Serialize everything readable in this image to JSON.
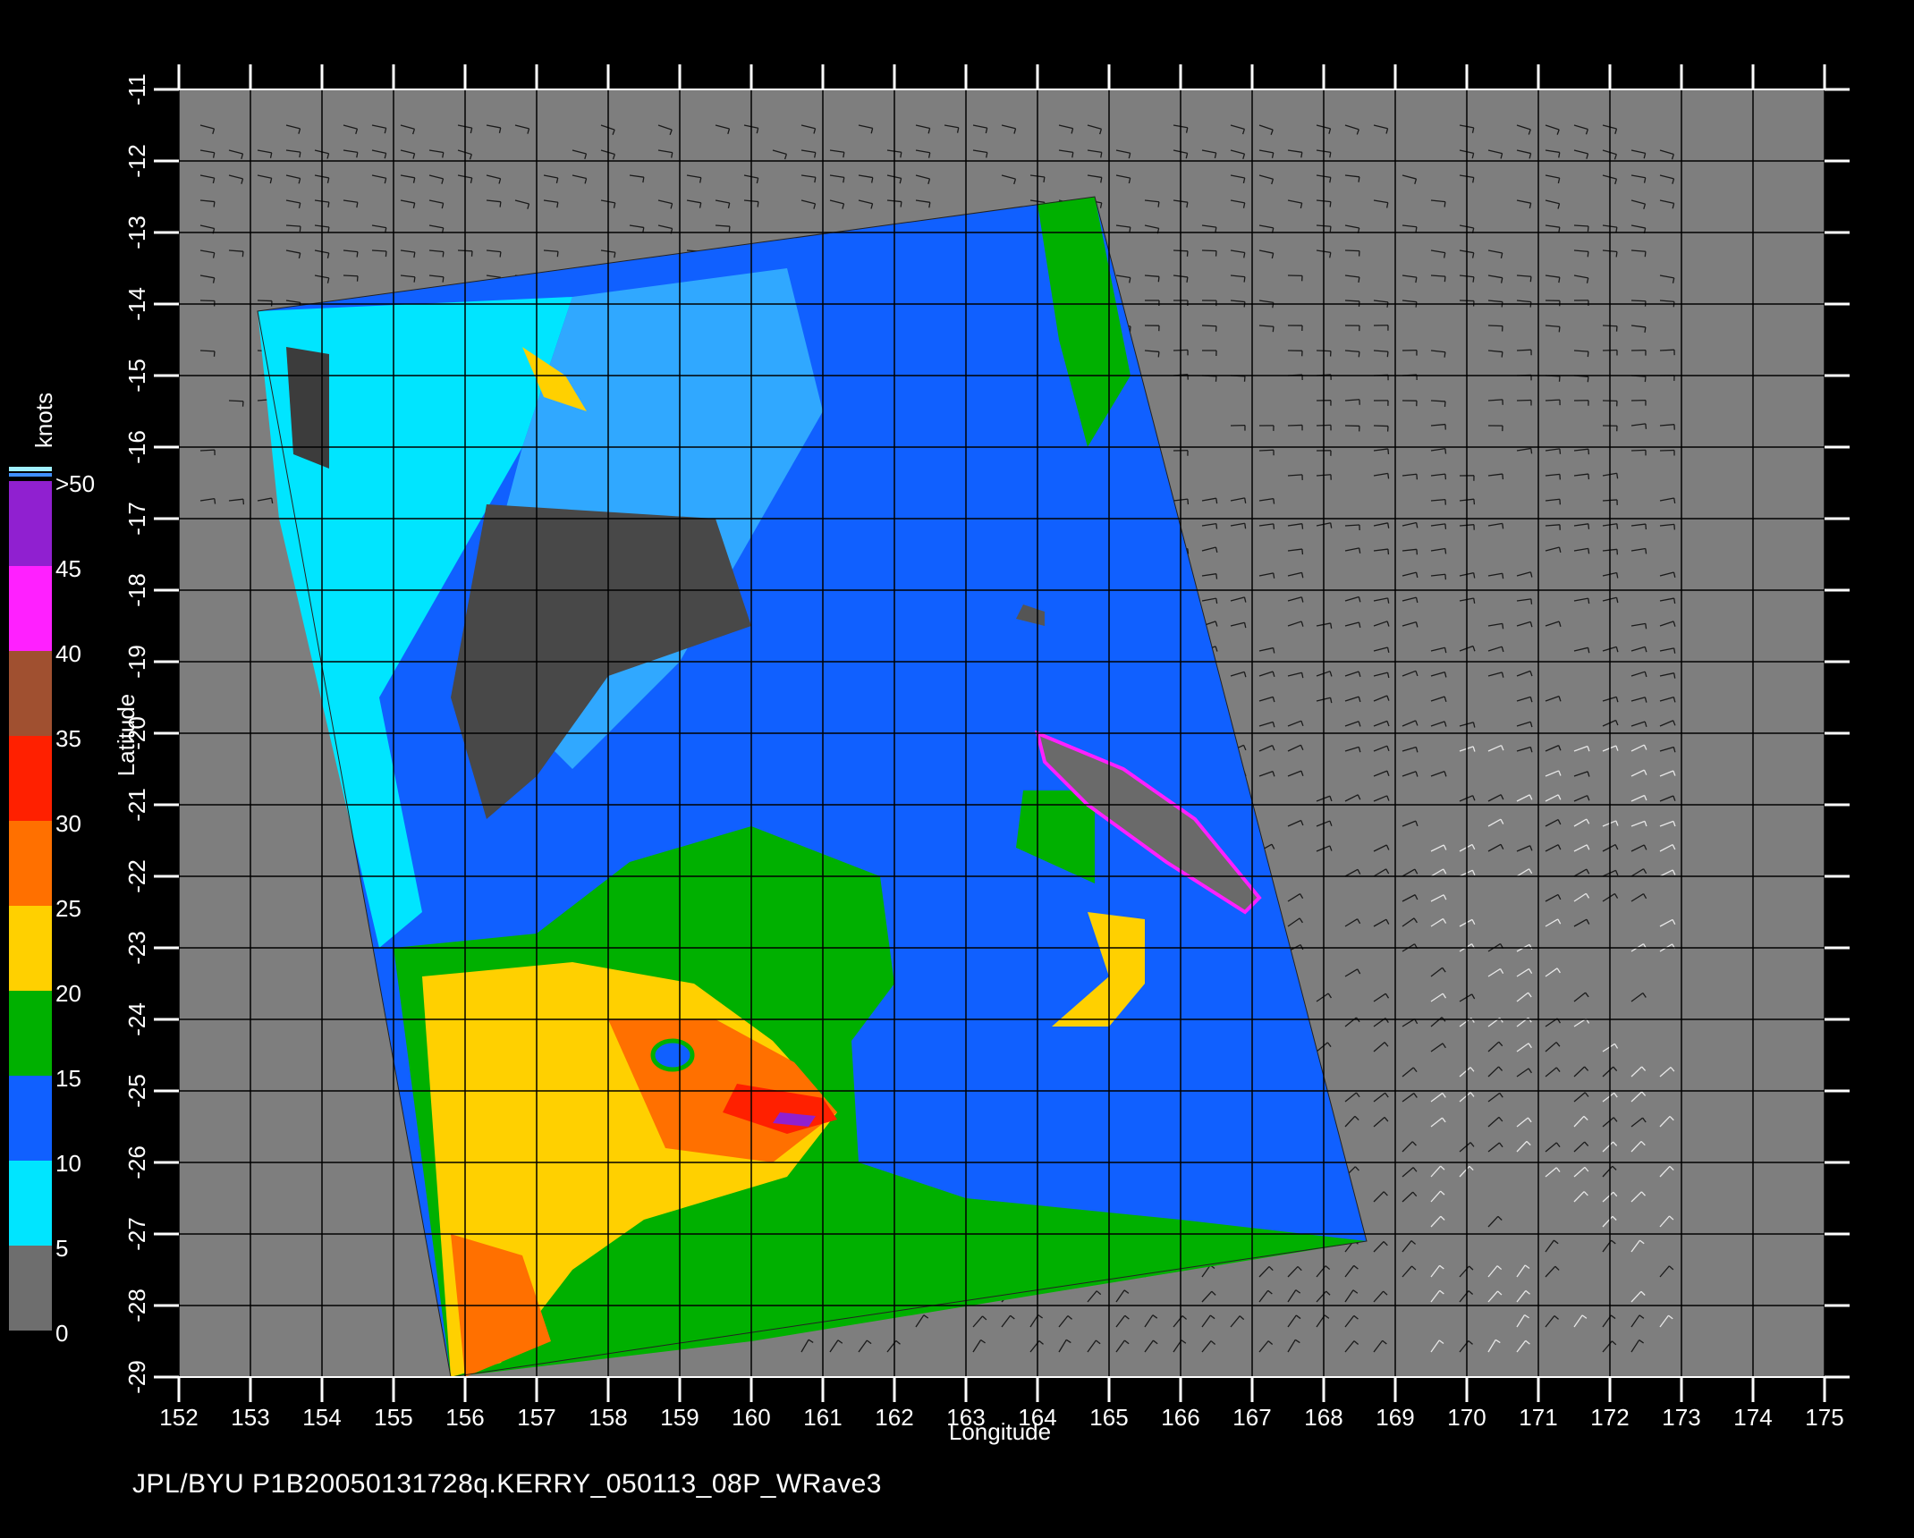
{
  "title": "JPL/BYU  P1B20050131728q.KERRY_050113_08P_WRave3",
  "axes": {
    "xlabel": "Longitude",
    "ylabel": "Latitude",
    "x_ticks": [
      "152",
      "153",
      "154",
      "155",
      "156",
      "157",
      "158",
      "159",
      "160",
      "161",
      "162",
      "163",
      "164",
      "165",
      "166",
      "167",
      "168",
      "169",
      "170",
      "171",
      "172",
      "173",
      "174",
      "175"
    ],
    "y_ticks": [
      "-11",
      "-12",
      "-13",
      "-14",
      "-15",
      "-16",
      "-17",
      "-18",
      "-19",
      "-20",
      "-21",
      "-22",
      "-23",
      "-24",
      "-25",
      "-26",
      "-27",
      "-28",
      "-29"
    ],
    "xlim": [
      152,
      175
    ],
    "ylim": [
      -29,
      -11
    ]
  },
  "colorbar": {
    "unit": "knots",
    "labels": [
      ">50",
      "45",
      "40",
      "35",
      "30",
      "25",
      "20",
      "15",
      "10",
      "5",
      "0"
    ],
    "colors": {
      "0-5": "#6e6e6e",
      "5-10": "#00e5ff",
      "10-15": "#1060ff",
      "15-20": "#00b000",
      "20-25": "#ffd000",
      "25-30": "#ff7000",
      "30-35": "#ff2000",
      "35-40": "#a05030",
      "40-45": "#ff20ff",
      "45-50": "#9020d0"
    }
  },
  "swath": {
    "corners_lonlat": [
      [
        153.1,
        -14.1
      ],
      [
        164.8,
        -12.5
      ],
      [
        168.6,
        -27.1
      ],
      [
        155.8,
        -29.0
      ]
    ]
  },
  "features": {
    "storm_center": [
      159.0,
      -24.5
    ],
    "max_wind_region": [
      160.8,
      -25.3
    ],
    "new_caledonia": [
      [
        164.0,
        -20.0
      ],
      [
        167.0,
        -22.5
      ]
    ]
  }
}
